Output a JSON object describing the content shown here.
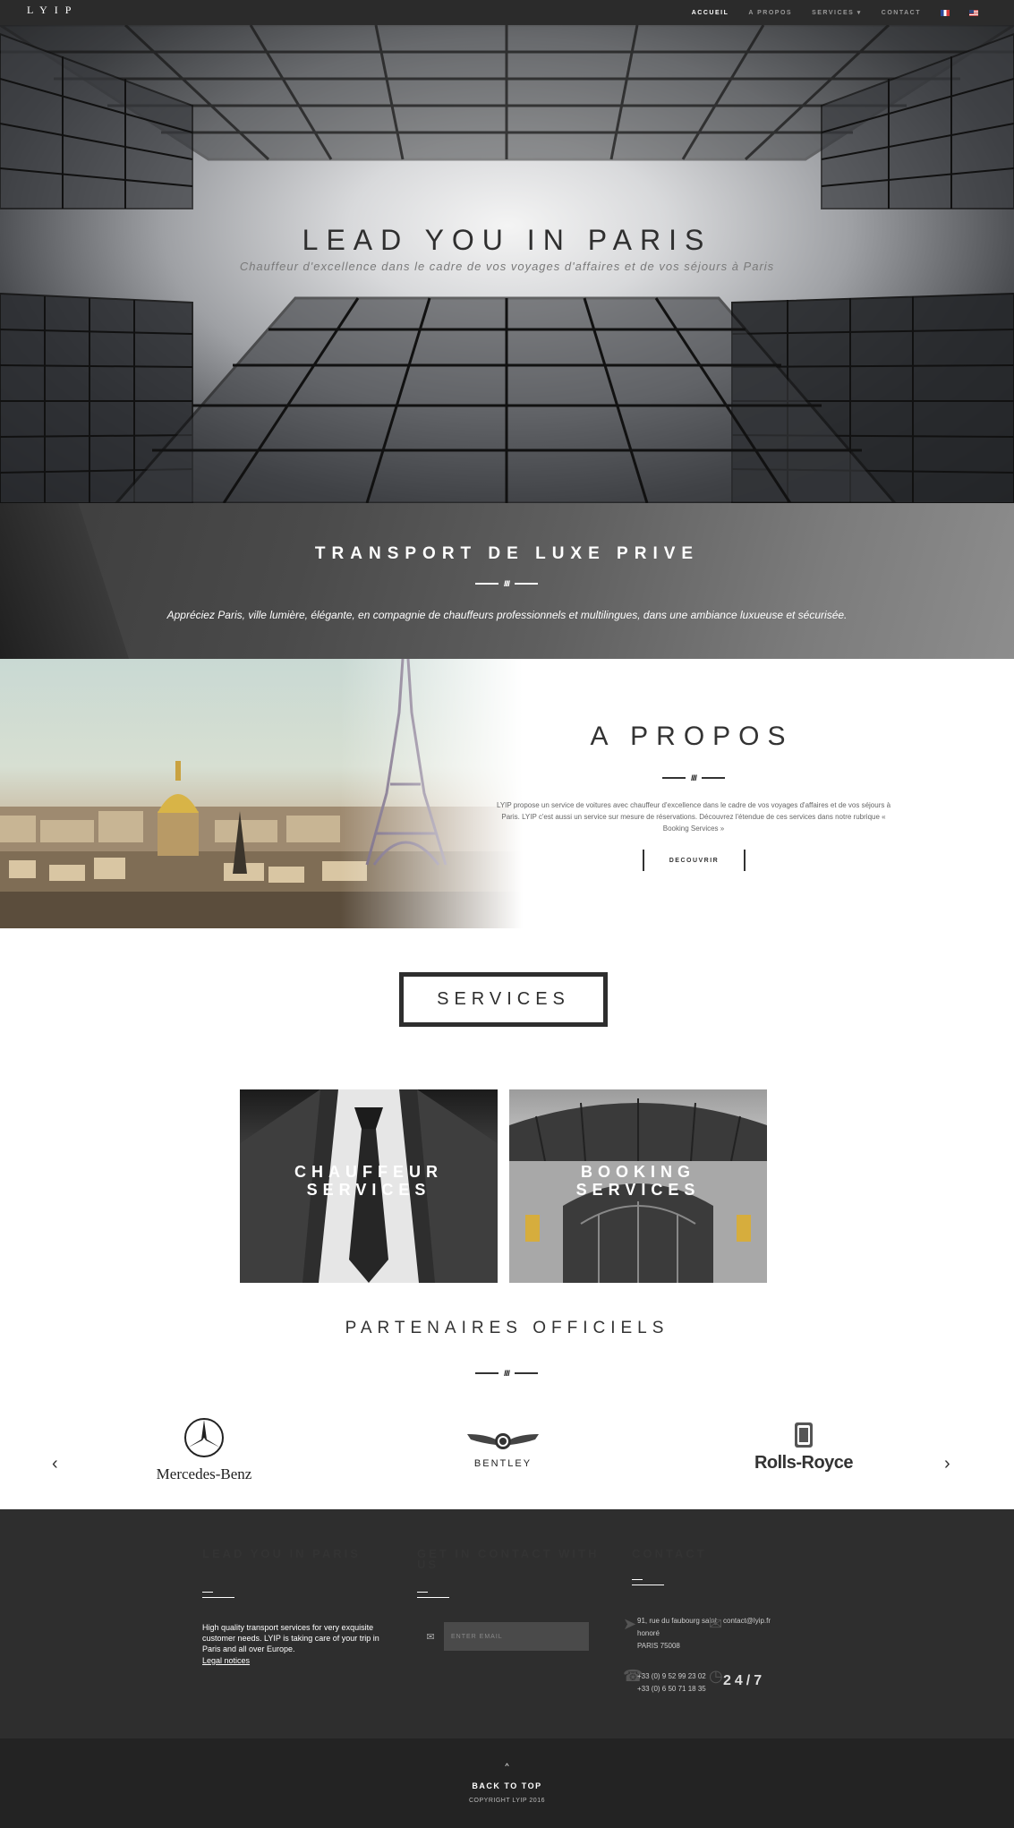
{
  "nav": {
    "logo": "LYIP",
    "items": [
      {
        "label": "ACCUEIL",
        "active": true
      },
      {
        "label": "A PROPOS",
        "active": false
      },
      {
        "label": "SERVICES ▾",
        "active": false
      },
      {
        "label": "CONTACT",
        "active": false
      }
    ],
    "flags": [
      "flag-fr-icon",
      "flag-en-icon"
    ]
  },
  "hero": {
    "title": "LEAD YOU IN PARIS",
    "subtitle": "Chauffeur d'excellence dans le cadre de vos voyages d'affaires et de vos séjours à Paris"
  },
  "luxe": {
    "title": "TRANSPORT DE LUXE PRIVE",
    "text": "Appréciez Paris, ville lumière, élégante, en compagnie de chauffeurs professionnels et multilingues, dans une ambiance luxueuse et sécurisée."
  },
  "apropos": {
    "title": "A PROPOS",
    "text": "LYIP propose un service de voitures avec chauffeur d'excellence dans le cadre de vos voyages d'affaires et de vos séjours à Paris. LYIP c'est aussi un service sur mesure de réservations. Découvrez l'étendue de ces services dans notre rubrique « Booking Services »",
    "button": "DECOUVRIR"
  },
  "services": {
    "title": "SERVICES",
    "cards": [
      {
        "line1": "CHAUFFEUR",
        "line2": "SERVICES"
      },
      {
        "line1": "BOOKING",
        "line2": "SERVICES"
      }
    ]
  },
  "partners": {
    "title": "PARTENAIRES OFFICIELS",
    "logos": [
      "Mercedes-Benz",
      "BENTLEY",
      "Rolls-Royce"
    ],
    "prev": "‹",
    "next": "›"
  },
  "footer": {
    "col1": {
      "title": "LEAD YOU IN PARIS",
      "text": "High quality transport services for very exquisite customer needs. LYIP is taking care of your trip in Paris and all over Europe.",
      "link": "Legal notices"
    },
    "col2": {
      "title": "GET IN CONTACT WITH US",
      "email_placeholder": "ENTER EMAIL"
    },
    "col3": {
      "title": "CONTACT",
      "address1": "91, rue du faubourg saint",
      "address2": "honoré",
      "address3": "PARIS 75008",
      "email": "contact@lyip.fr",
      "phone1": "+33 (0) 9 52 99 23 02",
      "phone2": "+33 (0) 6 50 71 18 35",
      "availability": "24/7"
    }
  },
  "bottom": {
    "arrow": "^",
    "back_to_top": "BACK TO TOP",
    "copyright": "COPYRIGHT LYIP 2016"
  }
}
